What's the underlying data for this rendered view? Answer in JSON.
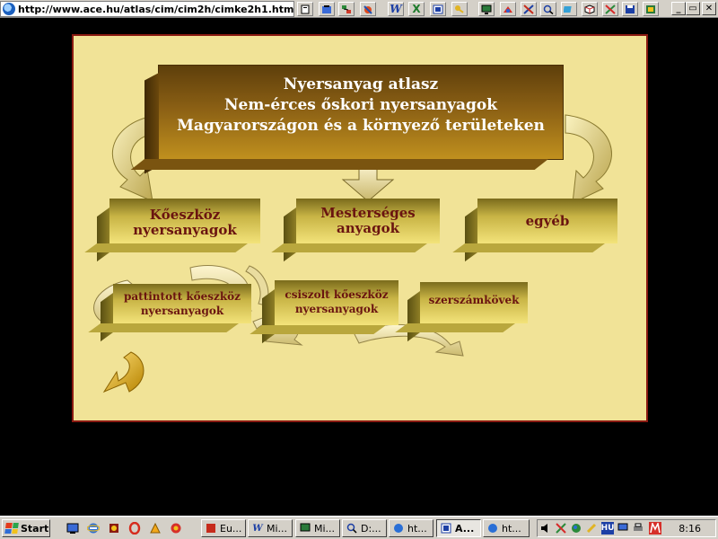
{
  "browser": {
    "address_url": "http://www.ace.hu/atlas/cim/cim2h/cimke2h1.htm"
  },
  "toolbar": {
    "icons": [
      "page-icon",
      "binder-icon",
      "network-icon",
      "dial-icon",
      "word-icon",
      "excel-icon",
      "access-icon",
      "keys-icon",
      "monitor-icon",
      "paint-icon",
      "tool-icon",
      "book-icon",
      "search-icon",
      "note-icon",
      "cube-icon",
      "pen-icon",
      "save-icon",
      "app-icon"
    ],
    "word_glyph": "W",
    "excel_glyph": "X",
    "minimize": "_",
    "restore": "▭",
    "close": "✕"
  },
  "slide": {
    "title_lines": [
      "Nyersanyag atlasz",
      "Nem-érces őskori nyersanyagok",
      "Magyarországon és a környező területeken"
    ],
    "categories": [
      {
        "lines": [
          "Kőeszköz",
          "nyersanyagok"
        ]
      },
      {
        "lines": [
          "Mesterséges",
          "anyagok"
        ]
      },
      {
        "lines": [
          "egyéb"
        ]
      }
    ],
    "subcategories": [
      {
        "lines": [
          "pattintott kőeszköz",
          "nyersanyagok"
        ]
      },
      {
        "lines": [
          "csiszolt kőeszköz",
          "nyersanyagok"
        ]
      },
      {
        "lines": [
          "szerszámkövek"
        ]
      }
    ],
    "colors": {
      "background": "#f1e397",
      "border": "#8a1a12",
      "title_text": "#ffffff",
      "label_text": "#6a1410"
    }
  },
  "taskbar": {
    "start_label": "Start",
    "quick_launch": [
      "desktop-icon",
      "ie-icon",
      "media-icon",
      "opera-icon",
      "winamp-icon",
      "app-icon"
    ],
    "tasks": [
      {
        "label": "Eu...",
        "icon": "excel-icon",
        "active": false
      },
      {
        "label": "Mi...",
        "icon": "word-icon",
        "active": false
      },
      {
        "label": "Mi...",
        "icon": "monitor-icon",
        "active": false
      },
      {
        "label": "D:...",
        "icon": "search-icon",
        "active": false
      },
      {
        "label": "ht...",
        "icon": "ie-icon",
        "active": false
      },
      {
        "label": "A...",
        "icon": "access-icon",
        "active": true
      },
      {
        "label": "ht...",
        "icon": "ie-icon",
        "active": false
      }
    ],
    "tray": {
      "language": "HU",
      "clock": "8:16"
    }
  }
}
